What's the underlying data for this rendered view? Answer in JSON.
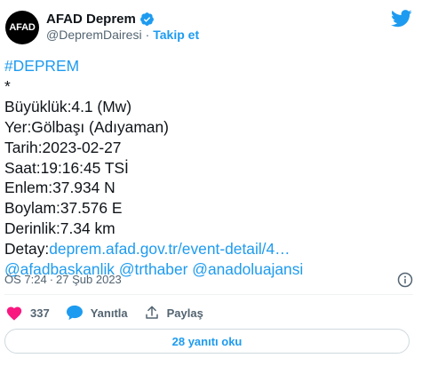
{
  "author": {
    "avatar_text": "AFAD",
    "name": "AFAD Deprem",
    "handle": "@DepremDairesi",
    "separator": "·",
    "follow_label": "Takip et"
  },
  "tweet": {
    "hashtag": "#DEPREM",
    "star": "*",
    "magnitude": "Büyüklük:4.1 (Mw)",
    "location": "Yer:Gölbaşı (Adıyaman)",
    "date": "Tarih:2023-02-27",
    "time": "Saat:19:16:45 TSİ",
    "latitude": "Enlem:37.934 N",
    "longitude": "Boylam:37.576 E",
    "depth": "Derinlik:7.34 km",
    "detail_prefix": "Detay:",
    "detail_link": "deprem.afad.gov.tr/event-detail/4…",
    "mentions": [
      "@afadbaskanlik",
      "@trthaber",
      "@anadoluajansi"
    ]
  },
  "meta": {
    "time": "ÖS 7:24",
    "separator": "·",
    "date": "27 Şub 2023"
  },
  "actions": {
    "likes": "337",
    "reply_label": "Yanıtla",
    "share_label": "Paylaş"
  },
  "replies_button": "28 yanıtı oku",
  "colors": {
    "accent": "#1d9bf0",
    "like": "#f91880",
    "text": "#0f1419",
    "muted": "#536471"
  }
}
